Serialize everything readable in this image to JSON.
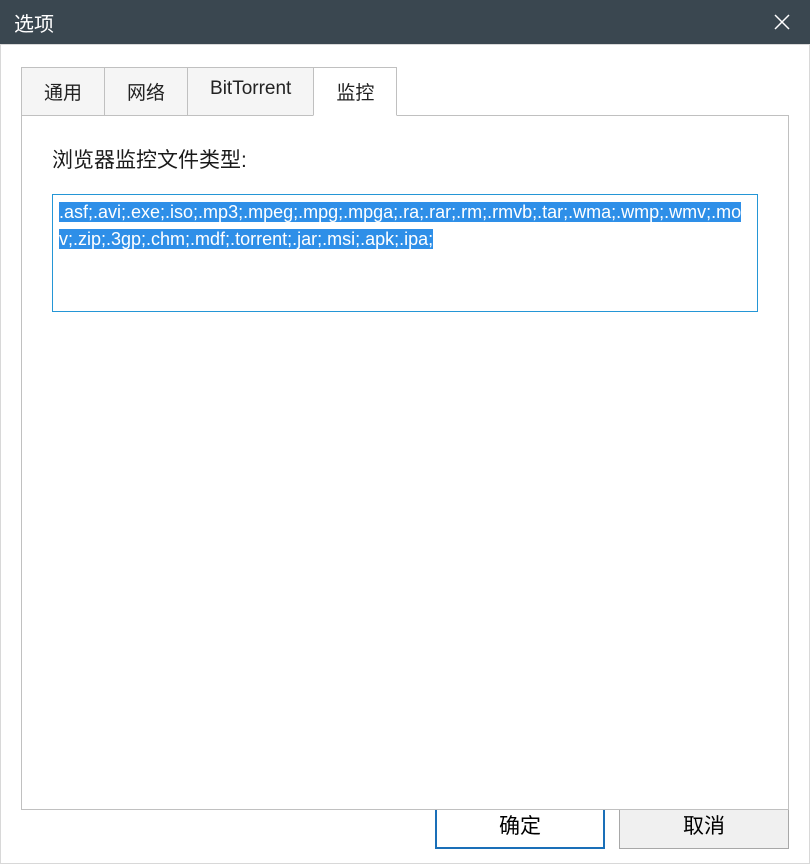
{
  "window": {
    "title": "选项"
  },
  "tabs": {
    "general": "通用",
    "network": "网络",
    "bittorrent": "BitTorrent",
    "monitoring": "监控"
  },
  "content": {
    "label": "浏览器监控文件类型:",
    "file_types": ".asf;.avi;.exe;.iso;.mp3;.mpeg;.mpg;.mpga;.ra;.rar;.rm;.rmvb;.tar;.wma;.wmp;.wmv;.mov;.zip;.3gp;.chm;.mdf;.torrent;.jar;.msi;.apk;.ipa;"
  },
  "buttons": {
    "ok": "确定",
    "cancel": "取消"
  }
}
